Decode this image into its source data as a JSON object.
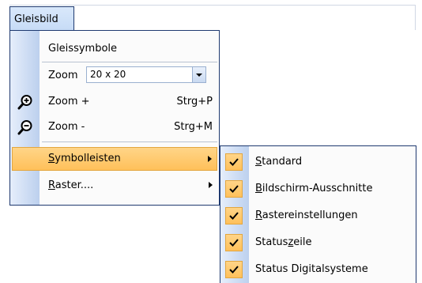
{
  "menubar": {
    "title": "Gleisbild"
  },
  "menu": {
    "items": [
      {
        "label": "Gleissymbole"
      },
      {
        "label": "Zoom",
        "combo_value": "20 x 20"
      },
      {
        "label": "Zoom +",
        "shortcut": "Strg+P",
        "icon": "zoom-in-icon"
      },
      {
        "label": "Zoom -",
        "shortcut": "Strg+M",
        "icon": "zoom-out-icon"
      },
      {
        "label_first": "S",
        "label_rest": "ymbolleisten",
        "has_submenu": true,
        "highlighted": true
      },
      {
        "label_first": "R",
        "label_rest": "aster....",
        "has_submenu": true
      }
    ]
  },
  "submenu": {
    "items": [
      {
        "label_first": "S",
        "label_rest": "tandard",
        "checked": true
      },
      {
        "label_first": "B",
        "label_rest": "ildschirm-Ausschnitte",
        "checked": true
      },
      {
        "label_first": "R",
        "label_rest": "astereinstellungen",
        "checked": true
      },
      {
        "label_pre": "Status",
        "label_u": "z",
        "label_post": "eile",
        "checked": true
      },
      {
        "label": "Status Digitalsysteme",
        "checked": true
      }
    ]
  },
  "colors": {
    "highlight": "#ffc05a",
    "border": "#1f3a70",
    "gutter": "#bcd0ee"
  }
}
